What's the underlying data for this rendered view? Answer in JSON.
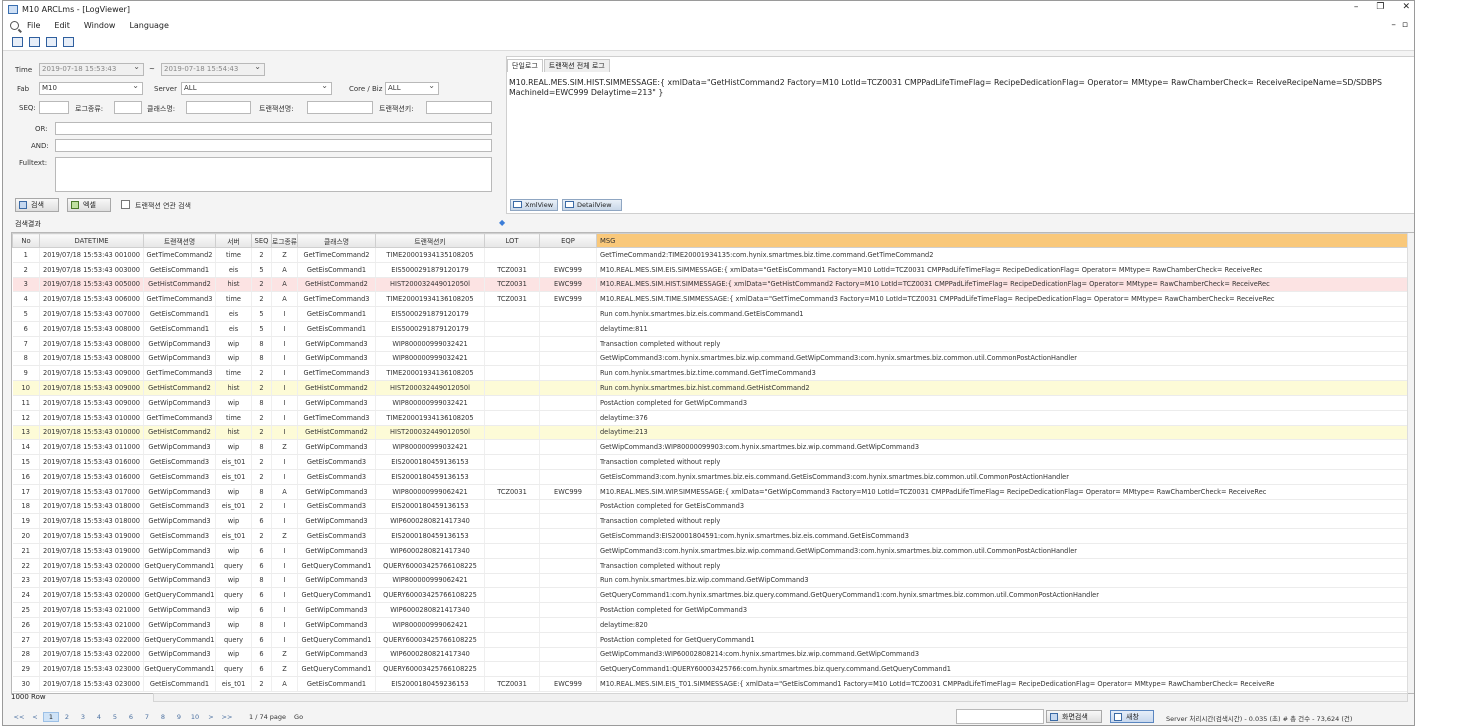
{
  "window": {
    "title": "M10 ARCLms - [LogViewer]",
    "controls": [
      "–",
      "❐",
      "✕"
    ],
    "mdi_controls": [
      "–",
      "▫"
    ]
  },
  "menu": [
    "File",
    "Edit",
    "Window",
    "Language"
  ],
  "toolbar_icons": [
    "new-window-icon",
    "copy-window-icon",
    "tile-vertical-icon",
    "tile-horizontal-icon"
  ],
  "search": {
    "time_label": "Time",
    "time_from": "2019-07-18 15:53:43",
    "time_sep": "~",
    "time_to": "2019-07-18 15:54:43",
    "fab_label": "Fab",
    "fab_value": "M10",
    "server_label": "Server",
    "server_value": "ALL",
    "core_label": "Core / Biz",
    "core_value": "ALL",
    "seq_label": "SEQ:",
    "log_type_label": "로그종류:",
    "class_label": "클래스명:",
    "tx_name_label": "트랜잭션명:",
    "tx_key_label": "트랜잭션키:",
    "or_label": "OR:",
    "and_label": "AND:",
    "fulltext_label": "Fulltext:",
    "search_button": "검색",
    "excel_button": "엑셀",
    "tx_related_label": "트랜잭션 연관 검색"
  },
  "detail": {
    "tab_single": "단일로그",
    "tab_all": "트랜잭션 전체 로그",
    "message_line1": "M10.REAL.MES.SIM.HIST.SIMMESSAGE:{ xmlData=\"GetHistCommand2 Factory=M10 LotId=TCZ0031 CMPPadLifeTimeFlag= RecipeDedicationFlag= Operator= MMtype= RawChamberCheck= ReceiveRecipeName=SD/SDBPS",
    "message_line2": "MachineId=EWC999 Delaytime=213\" }",
    "xml_button": "XmlView",
    "detail_button": "DetailView"
  },
  "results_title": "검색결과",
  "grid": {
    "columns": [
      "No",
      "DATETIME",
      "트랜잭션명",
      "서버",
      "SEQ",
      "로그종류",
      "클래스명",
      "트랜잭션키",
      "LOT",
      "EQP",
      "MSG"
    ],
    "rows": [
      [
        "1",
        "2019/07/18 15:53:43 001000",
        "GetTimeCommand2",
        "time",
        "2",
        "Z",
        "GetTimeCommand2",
        "TIME20001934135108205",
        "",
        "",
        "GetTimeCommand2:TIME20001934135:com.hynix.smartmes.biz.time.command.GetTimeCommand2"
      ],
      [
        "2",
        "2019/07/18 15:53:43 003000",
        "GetEisCommand1",
        "eis",
        "5",
        "A",
        "GetEisCommand1",
        "EIS5000291879120179",
        "TCZ0031",
        "EWC999",
        "M10.REAL.MES.SIM.EIS.SIMMESSAGE:{ xmlData=\"GetEisCommand1 Factory=M10 LotId=TCZ0031 CMPPadLifeTimeFlag= RecipeDedicationFlag= Operator= MMtype= RawChamberCheck= ReceiveRec"
      ],
      [
        "3",
        "2019/07/18 15:53:43 005000",
        "GetHistCommand2",
        "hist",
        "2",
        "A",
        "GetHistCommand2",
        "HIST200032449012050l",
        "TCZ0031",
        "EWC999",
        "M10.REAL.MES.SIM.HIST.SIMMESSAGE:{ xmlData=\"GetHistCommand2 Factory=M10 LotId=TCZ0031 CMPPadLifeTimeFlag= RecipeDedicationFlag= Operator= MMtype= RawChamberCheck= ReceiveRec"
      ],
      [
        "4",
        "2019/07/18 15:53:43 006000",
        "GetTimeCommand3",
        "time",
        "2",
        "A",
        "GetTimeCommand3",
        "TIME20001934136108205",
        "TCZ0031",
        "EWC999",
        "M10.REAL.MES.SIM.TIME.SIMMESSAGE:{ xmlData=\"GetTimeCommand3 Factory=M10 LotId=TCZ0031 CMPPadLifeTimeFlag= RecipeDedicationFlag= Operator= MMtype= RawChamberCheck= ReceiveRec"
      ],
      [
        "5",
        "2019/07/18 15:53:43 007000",
        "GetEisCommand1",
        "eis",
        "5",
        "I",
        "GetEisCommand1",
        "EIS5000291879120179",
        "",
        "",
        "Run com.hynix.smartmes.biz.eis.command.GetEisCommand1"
      ],
      [
        "6",
        "2019/07/18 15:53:43 008000",
        "GetEisCommand1",
        "eis",
        "5",
        "I",
        "GetEisCommand1",
        "EIS5000291879120179",
        "",
        "",
        "delaytime:811"
      ],
      [
        "7",
        "2019/07/18 15:53:43 008000",
        "GetWipCommand3",
        "wip",
        "8",
        "I",
        "GetWipCommand3",
        "WIP800000999032421",
        "",
        "",
        "Transaction completed without reply"
      ],
      [
        "8",
        "2019/07/18 15:53:43 008000",
        "GetWipCommand3",
        "wip",
        "8",
        "I",
        "GetWipCommand3",
        "WIP800000999032421",
        "",
        "",
        "GetWipCommand3:com.hynix.smartmes.biz.wip.command.GetWipCommand3:com.hynix.smartmes.biz.common.util.CommonPostActionHandler"
      ],
      [
        "9",
        "2019/07/18 15:53:43 009000",
        "GetTimeCommand3",
        "time",
        "2",
        "I",
        "GetTimeCommand3",
        "TIME20001934136108205",
        "",
        "",
        "Run com.hynix.smartmes.biz.time.command.GetTimeCommand3"
      ],
      [
        "10",
        "2019/07/18 15:53:43 009000",
        "GetHistCommand2",
        "hist",
        "2",
        "I",
        "GetHistCommand2",
        "HIST200032449012050l",
        "",
        "",
        "Run com.hynix.smartmes.biz.hist.command.GetHistCommand2"
      ],
      [
        "11",
        "2019/07/18 15:53:43 009000",
        "GetWipCommand3",
        "wip",
        "8",
        "I",
        "GetWipCommand3",
        "WIP800000999032421",
        "",
        "",
        "PostAction completed for GetWipCommand3"
      ],
      [
        "12",
        "2019/07/18 15:53:43 010000",
        "GetTimeCommand3",
        "time",
        "2",
        "I",
        "GetTimeCommand3",
        "TIME20001934136108205",
        "",
        "",
        "delaytime:376"
      ],
      [
        "13",
        "2019/07/18 15:53:43 010000",
        "GetHistCommand2",
        "hist",
        "2",
        "I",
        "GetHistCommand2",
        "HIST200032449012050l",
        "",
        "",
        "delaytime:213"
      ],
      [
        "14",
        "2019/07/18 15:53:43 011000",
        "GetWipCommand3",
        "wip",
        "8",
        "Z",
        "GetWipCommand3",
        "WIP800000999032421",
        "",
        "",
        "GetWipCommand3:WIP80000099903:com.hynix.smartmes.biz.wip.command.GetWipCommand3"
      ],
      [
        "15",
        "2019/07/18 15:53:43 016000",
        "GetEisCommand3",
        "eis_t01",
        "2",
        "I",
        "GetEisCommand3",
        "EIS2000180459136153",
        "",
        "",
        "Transaction completed without reply"
      ],
      [
        "16",
        "2019/07/18 15:53:43 016000",
        "GetEisCommand3",
        "eis_t01",
        "2",
        "I",
        "GetEisCommand3",
        "EIS2000180459136153",
        "",
        "",
        "GetEisCommand3:com.hynix.smartmes.biz.eis.command.GetEisCommand3:com.hynix.smartmes.biz.common.util.CommonPostActionHandler"
      ],
      [
        "17",
        "2019/07/18 15:53:43 017000",
        "GetWipCommand3",
        "wip",
        "8",
        "A",
        "GetWipCommand3",
        "WIP800000999062421",
        "TCZ0031",
        "EWC999",
        "M10.REAL.MES.SIM.WIP.SIMMESSAGE:{ xmlData=\"GetWipCommand3 Factory=M10 LotId=TCZ0031 CMPPadLifeTimeFlag= RecipeDedicationFlag= Operator= MMtype= RawChamberCheck= ReceiveRec"
      ],
      [
        "18",
        "2019/07/18 15:53:43 018000",
        "GetEisCommand3",
        "eis_t01",
        "2",
        "I",
        "GetEisCommand3",
        "EIS2000180459136153",
        "",
        "",
        "PostAction completed for GetEisCommand3"
      ],
      [
        "19",
        "2019/07/18 15:53:43 018000",
        "GetWipCommand3",
        "wip",
        "6",
        "I",
        "GetWipCommand3",
        "WIP6000280821417340",
        "",
        "",
        "Transaction completed without reply"
      ],
      [
        "20",
        "2019/07/18 15:53:43 019000",
        "GetEisCommand3",
        "eis_t01",
        "2",
        "Z",
        "GetEisCommand3",
        "EIS2000180459136153",
        "",
        "",
        "GetEisCommand3:EIS20001804591:com.hynix.smartmes.biz.eis.command.GetEisCommand3"
      ],
      [
        "21",
        "2019/07/18 15:53:43 019000",
        "GetWipCommand3",
        "wip",
        "6",
        "I",
        "GetWipCommand3",
        "WIP6000280821417340",
        "",
        "",
        "GetWipCommand3:com.hynix.smartmes.biz.wip.command.GetWipCommand3:com.hynix.smartmes.biz.common.util.CommonPostActionHandler"
      ],
      [
        "22",
        "2019/07/18 15:53:43 020000",
        "GetQueryCommand1",
        "query",
        "6",
        "I",
        "GetQueryCommand1",
        "QUERY60003425766108225",
        "",
        "",
        "Transaction completed without reply"
      ],
      [
        "23",
        "2019/07/18 15:53:43 020000",
        "GetWipCommand3",
        "wip",
        "8",
        "I",
        "GetWipCommand3",
        "WIP800000999062421",
        "",
        "",
        "Run com.hynix.smartmes.biz.wip.command.GetWipCommand3"
      ],
      [
        "24",
        "2019/07/18 15:53:43 020000",
        "GetQueryCommand1",
        "query",
        "6",
        "I",
        "GetQueryCommand1",
        "QUERY60003425766108225",
        "",
        "",
        "GetQueryCommand1:com.hynix.smartmes.biz.query.command.GetQueryCommand1:com.hynix.smartmes.biz.common.util.CommonPostActionHandler"
      ],
      [
        "25",
        "2019/07/18 15:53:43 021000",
        "GetWipCommand3",
        "wip",
        "6",
        "I",
        "GetWipCommand3",
        "WIP6000280821417340",
        "",
        "",
        "PostAction completed for GetWipCommand3"
      ],
      [
        "26",
        "2019/07/18 15:53:43 021000",
        "GetWipCommand3",
        "wip",
        "8",
        "I",
        "GetWipCommand3",
        "WIP800000999062421",
        "",
        "",
        "delaytime:820"
      ],
      [
        "27",
        "2019/07/18 15:53:43 022000",
        "GetQueryCommand1",
        "query",
        "6",
        "I",
        "GetQueryCommand1",
        "QUERY60003425766108225",
        "",
        "",
        "PostAction completed for GetQueryCommand1"
      ],
      [
        "28",
        "2019/07/18 15:53:43 022000",
        "GetWipCommand3",
        "wip",
        "6",
        "Z",
        "GetWipCommand3",
        "WIP6000280821417340",
        "",
        "",
        "GetWipCommand3:WIP60002808214:com.hynix.smartmes.biz.wip.command.GetWipCommand3"
      ],
      [
        "29",
        "2019/07/18 15:53:43 023000",
        "GetQueryCommand1",
        "query",
        "6",
        "Z",
        "GetQueryCommand1",
        "QUERY60003425766108225",
        "",
        "",
        "GetQueryCommand1:QUERY60003425766:com.hynix.smartmes.biz.query.command.GetQueryCommand1"
      ],
      [
        "30",
        "2019/07/18 15:53:43 023000",
        "GetEisCommand1",
        "eis_t01",
        "2",
        "A",
        "GetEisCommand1",
        "EIS2000180459236153",
        "TCZ0031",
        "EWC999",
        "M10.REAL.MES.SIM.EIS_T01.SIMMESSAGE:{ xmlData=\"GetEisCommand1 Factory=M10 LotId=TCZ0031 CMPPadLifeTimeFlag= RecipeDedicationFlag= Operator= MMtype= RawChamberCheck= ReceiveRe"
      ]
    ],
    "highlight_colors": {
      "selected": "#fce3e3",
      "related": "#fdfbd7"
    }
  },
  "footer": {
    "row_count": "1000 Row",
    "pager_prev": [
      "<<",
      "<"
    ],
    "pages": [
      "1",
      "2",
      "3",
      "4",
      "5",
      "6",
      "7",
      "8",
      "9",
      "10"
    ],
    "pager_next": [
      ">",
      ">>"
    ],
    "page_info": "1 / 74 page",
    "go_label": "Go",
    "screen_search_button": "화면검색",
    "refresh_button": "새창",
    "status_text": "Server 처리시간(검색시간) - 0.035 (초) # 총 건수 - 73,624 (건)"
  }
}
